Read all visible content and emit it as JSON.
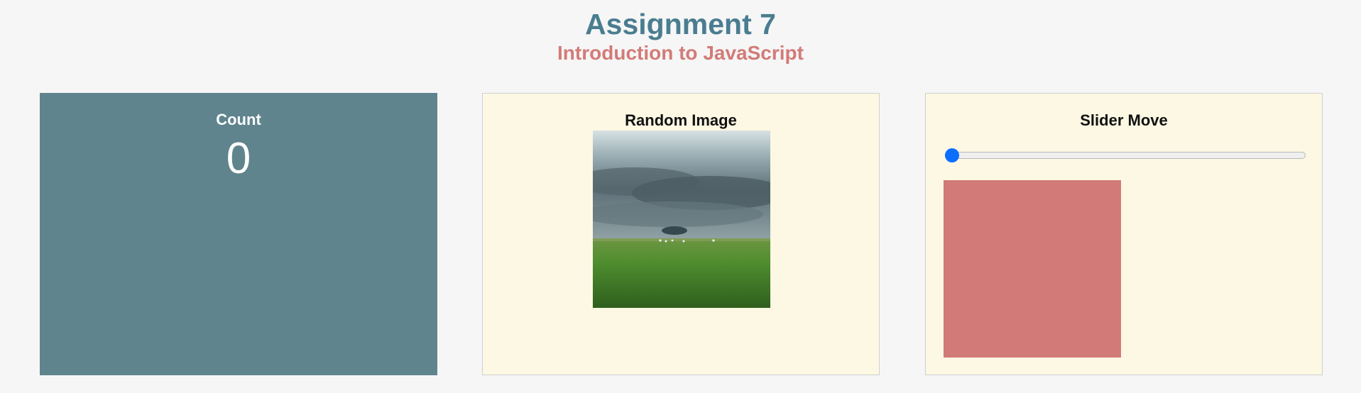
{
  "header": {
    "title": "Assignment 7",
    "subtitle": "Introduction to JavaScript"
  },
  "count_panel": {
    "title": "Count",
    "value": "0"
  },
  "image_panel": {
    "title": "Random Image",
    "image": "landscape with storm clouds over grassland"
  },
  "slider_panel": {
    "title": "Slider Move",
    "slider_value": 0,
    "box_color": "#d17a77"
  },
  "colors": {
    "title": "#4a7d90",
    "subtitle": "#d27b78",
    "count_panel_bg": "#5f848d",
    "panel_bg": "#fdf8e3",
    "slider_thumb": "#0d6efd"
  }
}
